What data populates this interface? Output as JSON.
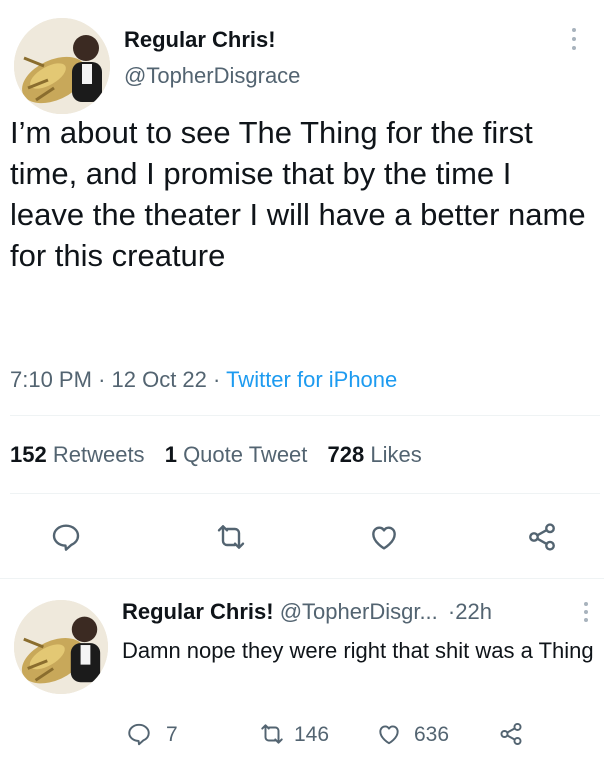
{
  "tweet": {
    "author_name": "Regular Chris!",
    "author_handle": "@TopherDisgrace",
    "text": "I’m about to see The Thing for the first time, and I promise that by the time I leave the theater I will have a better name for this creature",
    "time": "7:10 PM",
    "sep1": "·",
    "date": "12 Oct 22",
    "sep2": "·",
    "source": "Twitter for iPhone",
    "stats": {
      "retweets_count": "152",
      "retweets_label": "Retweets",
      "quotes_count": "1",
      "quotes_label": "Quote Tweet",
      "likes_count": "728",
      "likes_label": "Likes"
    },
    "actions": [
      "reply-icon",
      "retweet-icon",
      "like-icon",
      "share-icon"
    ]
  },
  "reply": {
    "author_name": "Regular Chris!",
    "author_handle_truncated": "@TopherDisgr...",
    "sep": "·",
    "age": "22h",
    "text": "Damn nope they were right that shit was a Thing",
    "reply_count": "7",
    "retweet_count": "146",
    "like_count": "636"
  },
  "colors": {
    "accent": "#1d9bf0",
    "text": "#0f1419",
    "secondary": "#536471",
    "divider": "#eff3f4"
  }
}
